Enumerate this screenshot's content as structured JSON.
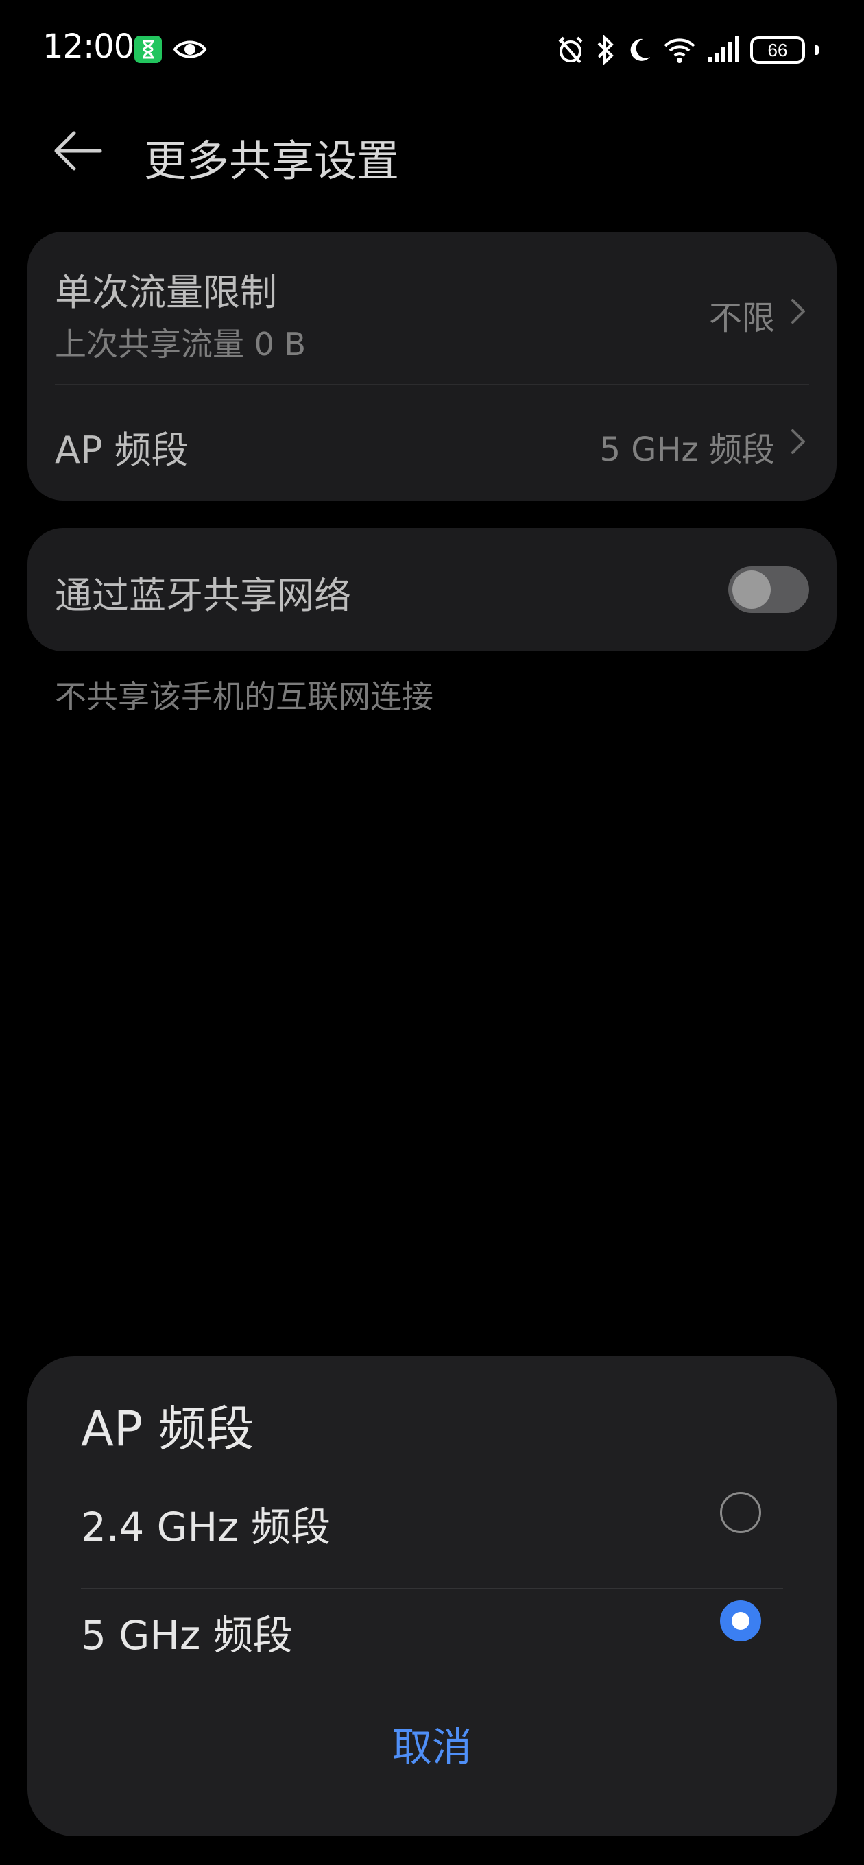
{
  "status_bar": {
    "time": "12:00",
    "battery_level": "66"
  },
  "header": {
    "title": "更多共享设置"
  },
  "settings": {
    "traffic_limit": {
      "label": "单次流量限制",
      "sub": "上次共享流量 0 B",
      "value": "不限"
    },
    "ap_band": {
      "label": "AP 频段",
      "value": "5 GHz 频段"
    },
    "bluetooth_share": {
      "label": "通过蓝牙共享网络",
      "enabled": false
    },
    "footnote": "不共享该手机的互联网连接"
  },
  "dialog": {
    "title": "AP 频段",
    "options": [
      {
        "label": "2.4 GHz 频段",
        "selected": false
      },
      {
        "label": "5 GHz 频段",
        "selected": true
      }
    ],
    "cancel_label": "取消"
  },
  "colors": {
    "accent": "#3b7ff2",
    "cancel_text": "#4f8ff7",
    "card_bg": "#1c1c1e",
    "sheet_bg": "#1f1f21",
    "hourglass_badge": "#22c55e"
  }
}
